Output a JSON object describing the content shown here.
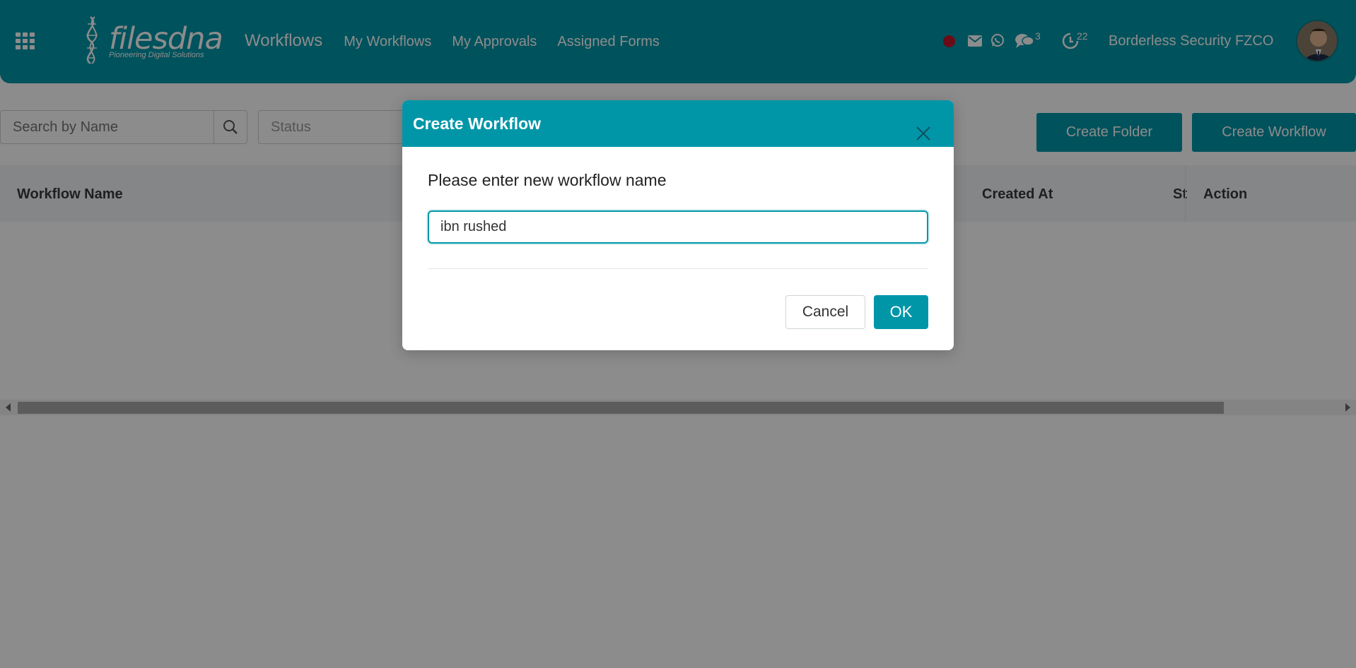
{
  "header": {
    "logo": {
      "brand": "filesdna",
      "tagline": "Pioneering Digital Solutions"
    },
    "nav": {
      "main": "Workflows",
      "items": [
        "My Workflows",
        "My Approvals",
        "Assigned Forms"
      ]
    },
    "icons": [
      "apps-grid-icon",
      "record-icon",
      "mail-icon",
      "whatsapp-icon",
      "chat-icon",
      "history-icon"
    ],
    "chat_count": "3",
    "history_count": "22",
    "company": "Borderless Security FZCO",
    "accent_color": "#0096a8",
    "record_color": "#c0162b"
  },
  "toolbar": {
    "search_placeholder": "Search by Name",
    "status_placeholder": "Status",
    "create_folder": "Create Folder",
    "create_workflow": "Create Workflow"
  },
  "table": {
    "columns": [
      "Workflow Name",
      "Created At",
      "St",
      "Action"
    ],
    "rows": []
  },
  "modal": {
    "title": "Create Workflow",
    "prompt": "Please enter new workflow name",
    "input_value": "ibn rushed",
    "cancel_label": "Cancel",
    "ok_label": "OK"
  }
}
